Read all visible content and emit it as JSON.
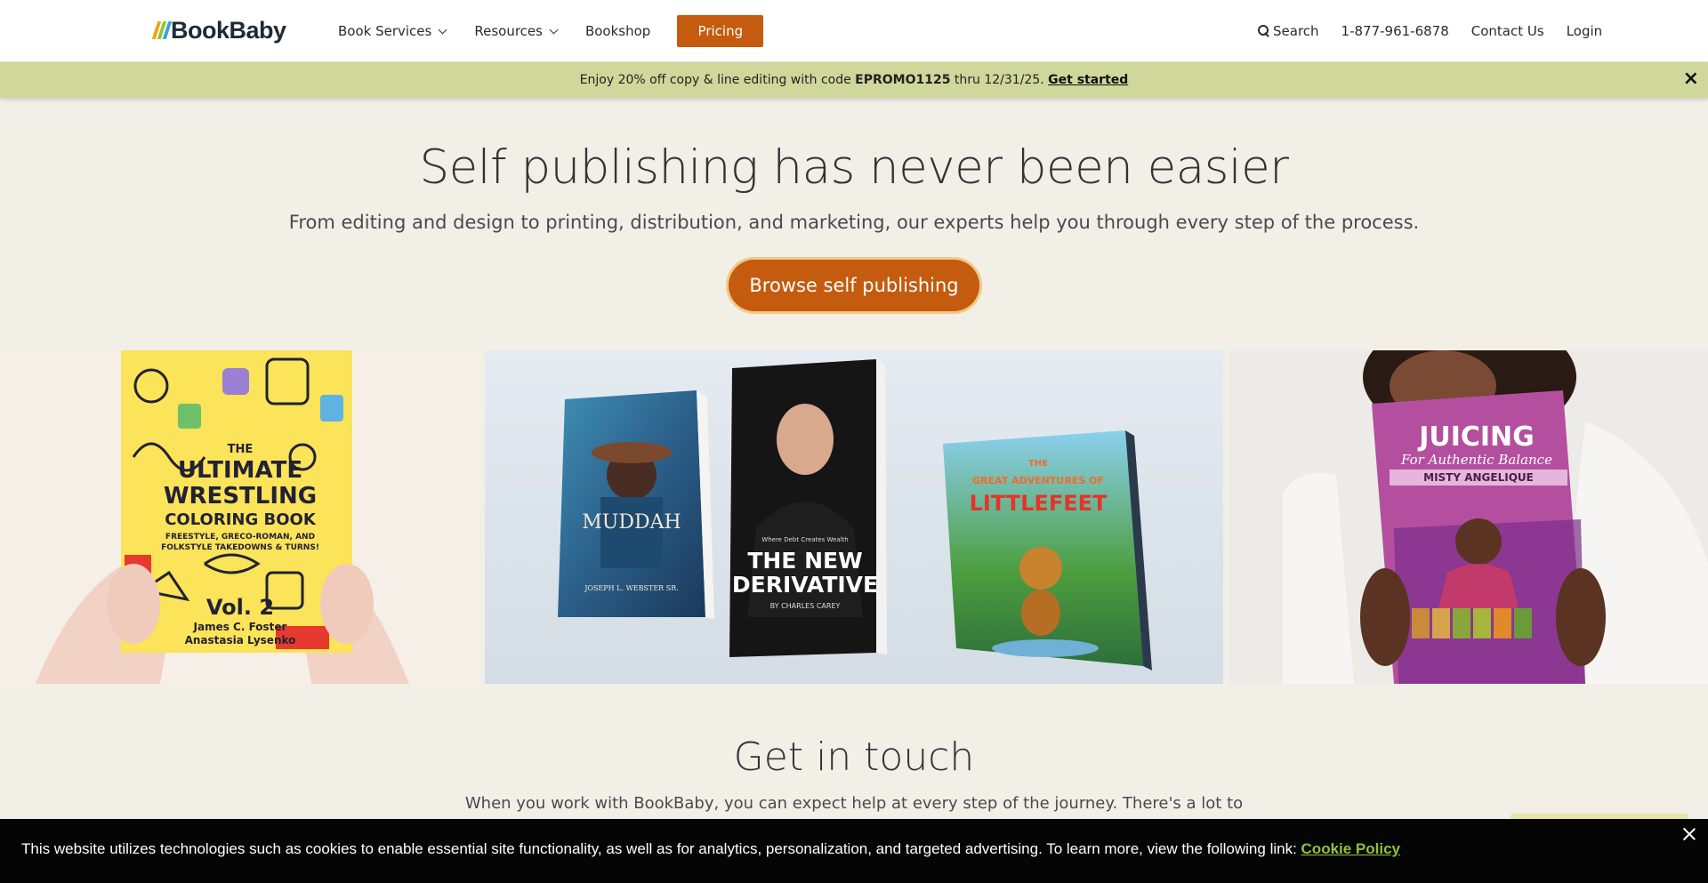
{
  "brand": {
    "name": "BookBaby",
    "slash_colors": [
      "#f2a20f",
      "#8cc63f",
      "#3aa0d8"
    ],
    "accent": "#c45b0e",
    "promo_bg": "#cfd89a"
  },
  "nav": {
    "book_services": "Book Services",
    "resources": "Resources",
    "bookshop": "Bookshop",
    "pricing": "Pricing",
    "search": "Search",
    "phone": "1-877-961-6878",
    "contact": "Contact Us",
    "login": "Login"
  },
  "promo": {
    "text_before": "Enjoy 20% off copy & line editing with code ",
    "code": "EPROMO1125",
    "text_after": " thru 12/31/25. ",
    "cta": "Get started",
    "close": "×"
  },
  "hero": {
    "title": "Self publishing has never been easier",
    "subtitle": "From editing and design to printing, distribution, and marketing, our experts help you through every step of the process.",
    "button": "Browse self publishing"
  },
  "showcase": {
    "book1": {
      "l1": "THE",
      "l2": "ULTIMATE",
      "l3": "WRESTLING",
      "l4": "COLORING BOOK",
      "l5": "FREESTYLE, GRECO-ROMAN, AND",
      "l6": "FOLKSTYLE TAKEDOWNS & TURNS!",
      "vol": "Vol. 2",
      "author1": "James C. Foster",
      "author2": "Anastasia Lysenko"
    },
    "book2": {
      "title": "MUDDAH",
      "author": "JOSEPH L. WEBSTER SR."
    },
    "book3": {
      "tagline": "Where Debt Creates Wealth",
      "title1": "THE NEW",
      "title2": "DERIVATIVE",
      "author": "BY CHARLES CAREY"
    },
    "book4": {
      "t1": "THE",
      "t2": "GREAT ADVENTURES OF",
      "t3": "LITTLEFEET"
    },
    "book5": {
      "t1": "JUICING",
      "t2": "For Authentic Balance",
      "author": "MISTY ANGELIQUE"
    }
  },
  "contact": {
    "title": "Get in touch",
    "text": "When you work with BookBaby, you can expect help at every step of the journey. There's a lot to"
  },
  "cookie": {
    "text": "This website utilizes technologies such as cookies to enable essential site functionality, as well as for analytics, personalization, and targeted advertising. To learn more, view the following link: ",
    "link": "Cookie Policy"
  }
}
